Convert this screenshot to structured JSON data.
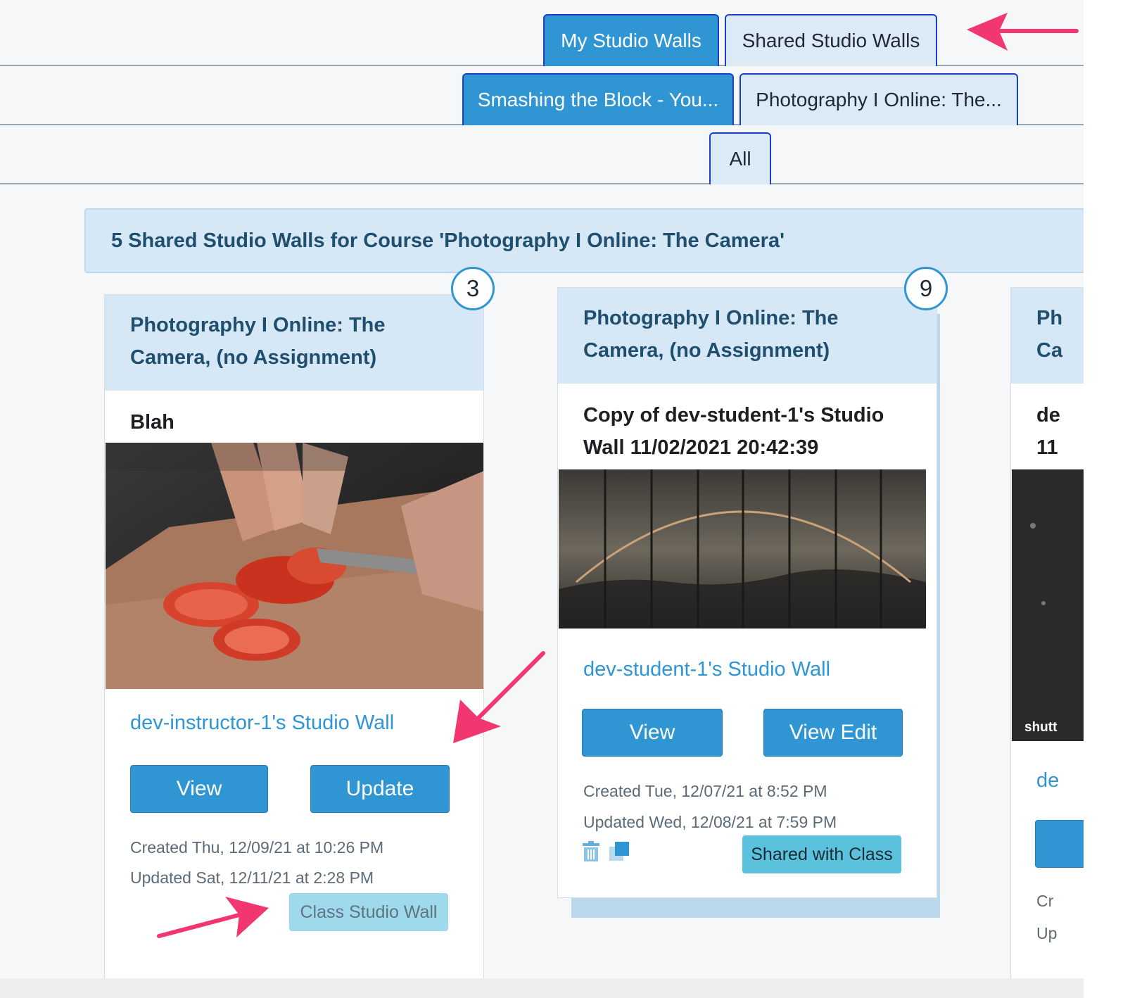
{
  "tabs": {
    "row1": [
      "My Studio Walls",
      "Shared Studio Walls"
    ],
    "row2": [
      "Smashing the Block - You...",
      "Photography I Online: The..."
    ],
    "row3": [
      "All"
    ]
  },
  "banner": "5 Shared Studio Walls for Course 'Photography I Online: The Camera'",
  "cards": [
    {
      "count": "3",
      "course_line1": "Photography I Online: The",
      "course_line2": "Camera, (no Assignment)",
      "title_line1": "Blah",
      "owner_name": "dev-instructor-1",
      "owner_suffix": "'s Studio Wall",
      "btn1": "View",
      "btn2": "Update",
      "created": "Created Thu, 12/09/21 at 10:26 PM",
      "updated": "Updated Sat, 12/11/21 at 2:28 PM",
      "badge": "Class Studio Wall"
    },
    {
      "count": "9",
      "course_line1": "Photography I Online: The",
      "course_line2": "Camera, (no Assignment)",
      "title_line1": "Copy of dev-student-1's Studio",
      "title_line2": "Wall 11/02/2021 20:42:39",
      "owner_name": "dev-student-1",
      "owner_suffix": "'s Studio Wall",
      "btn1": "View",
      "btn2": "View Edit",
      "created": "Created Tue, 12/07/21 at 8:52 PM",
      "updated": "Updated Wed, 12/08/21 at 7:59 PM",
      "badge": "Shared with Class",
      "icons": [
        "trash-icon",
        "copy-icon"
      ]
    },
    {
      "course_line1": "Ph",
      "course_line2": "Ca",
      "title_line1": "de",
      "title_line2": "11",
      "watermark": "shutt",
      "owner_name": "de",
      "created": "Cr",
      "updated": "Up"
    }
  ]
}
